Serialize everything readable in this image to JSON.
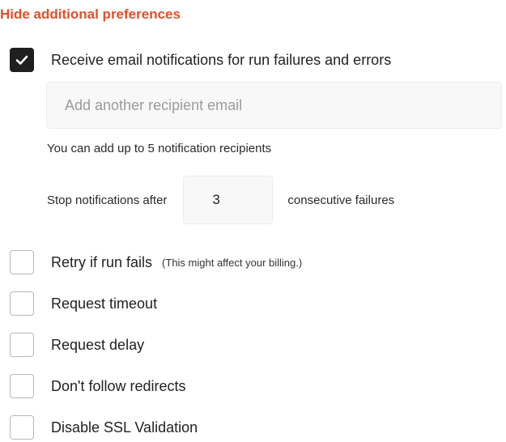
{
  "hide_link": "Hide additional preferences",
  "email_notifications": {
    "label": "Receive email notifications for run failures and errors",
    "checked": true,
    "recipient_placeholder": "Add another recipient email",
    "helper": "You can add up to 5 notification recipients",
    "stop_prefix": "Stop notifications after",
    "stop_value": "3",
    "stop_suffix": "consecutive failures"
  },
  "options": [
    {
      "label": "Retry if run fails",
      "note": "(This might affect your billing.)",
      "checked": false
    },
    {
      "label": "Request timeout",
      "checked": false
    },
    {
      "label": "Request delay",
      "checked": false
    },
    {
      "label": "Don't follow redirects",
      "checked": false
    },
    {
      "label": "Disable SSL Validation",
      "checked": false
    }
  ],
  "colors": {
    "accent": "#E0502A",
    "checkbox_checked": "#1F1F1F",
    "input_bg": "#F8F8F8"
  },
  "icons": {
    "checkmark": "checkmark-icon"
  }
}
